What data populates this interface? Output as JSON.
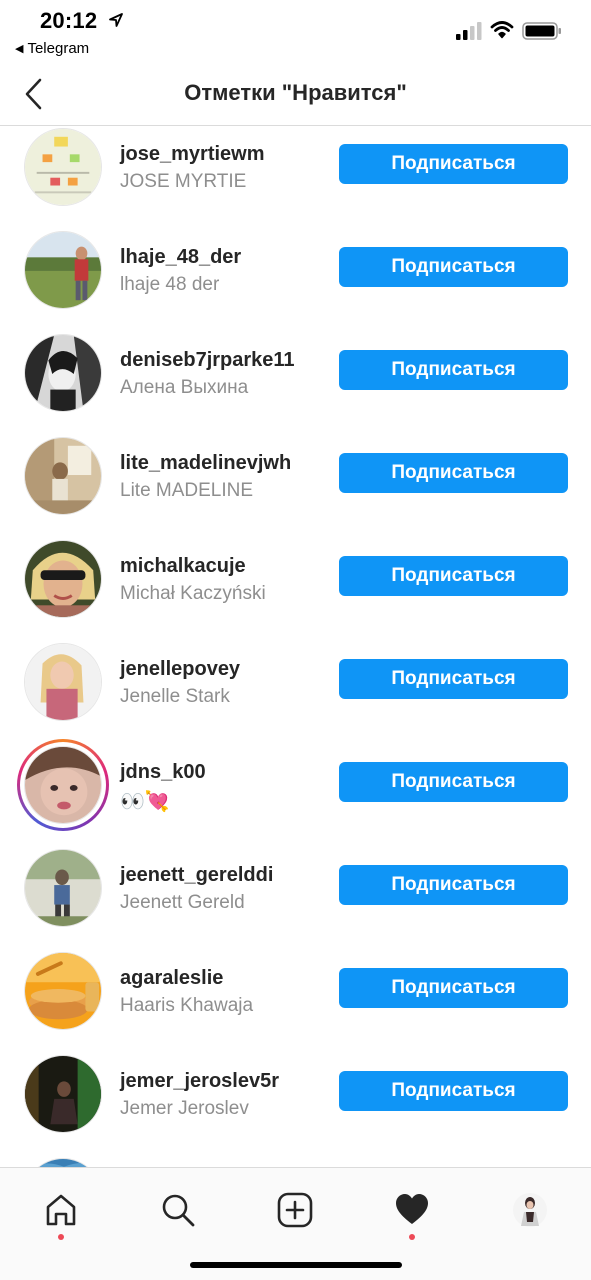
{
  "status_bar": {
    "time": "20:12",
    "back_app": "Telegram"
  },
  "header": {
    "title": "Отметки \"Нравится\""
  },
  "follow_label": "Подписаться",
  "users": [
    {
      "username": "jose_myrtiewm",
      "full_name": "JOSE MYRTIE"
    },
    {
      "username": "lhaje_48_der",
      "full_name": "lhaje 48 der"
    },
    {
      "username": "deniseb7jrparke11",
      "full_name": "Алена Выхина"
    },
    {
      "username": "lite_madelinevjwh",
      "full_name": "Lite MADELINE"
    },
    {
      "username": "michalkacuje",
      "full_name": "Michał Kaczyński"
    },
    {
      "username": "jenellepovey",
      "full_name": "Jenelle Stark"
    },
    {
      "username": "jdns_k00",
      "full_name": "👀💘",
      "has_story": true
    },
    {
      "username": "jeenett_gerelddi",
      "full_name": "Jeenett Gereld"
    },
    {
      "username": "agaraleslie",
      "full_name": "Haaris Khawaja"
    },
    {
      "username": "jemer_jeroslev5r",
      "full_name": "Jemer Jeroslev"
    }
  ],
  "tabbar": {
    "items": [
      "home-icon",
      "search-icon",
      "new-post-icon",
      "activity-heart-icon",
      "profile-avatar"
    ],
    "notification_dot_color": "#ed4956"
  },
  "colors": {
    "accent": "#0f95f6",
    "secondary_text": "#8e8e8e"
  }
}
